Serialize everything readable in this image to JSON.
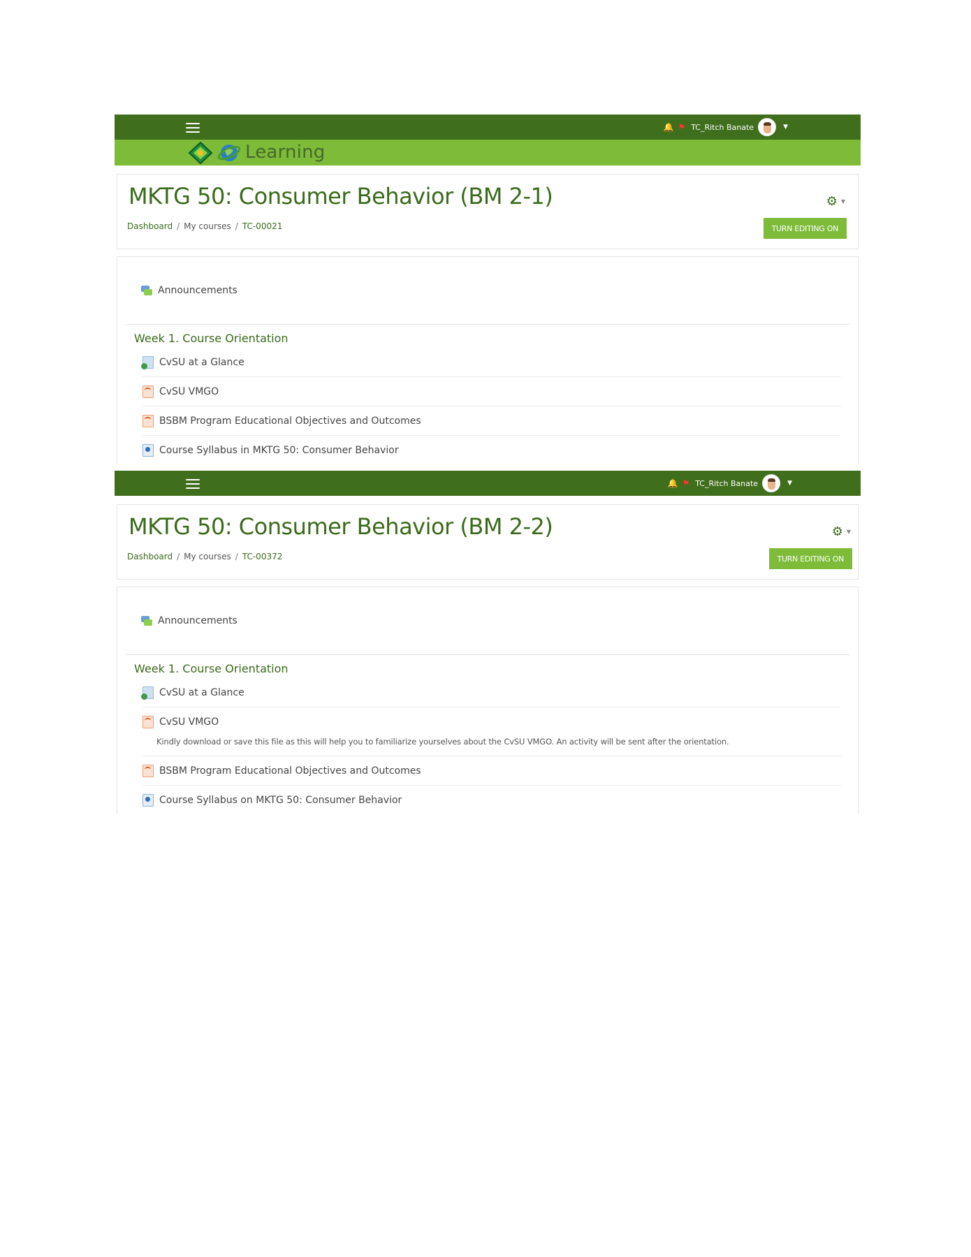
{
  "screens": [
    {
      "user": {
        "name": "TC_Ritch Banate"
      },
      "brand": {
        "logo_text": "Learning"
      },
      "course": {
        "title": "MKTG 50: Consumer Behavior (BM 2-1)",
        "breadcrumb": [
          "Dashboard",
          "My courses",
          "TC-00021"
        ],
        "edit_button": "TURN EDITING ON"
      },
      "announcements": "Announcements",
      "section": {
        "title": "Week 1. Course Orientation",
        "items": [
          {
            "icon": "url-icon",
            "label": "CvSU at a Glance"
          },
          {
            "icon": "pdf-icon",
            "label": "CvSU VMGO"
          },
          {
            "icon": "pdf-icon",
            "label": "BSBM Program Educational Objectives and Outcomes"
          },
          {
            "icon": "doc-icon",
            "label": "Course Syllabus in MKTG 50: Consumer Behavior"
          }
        ]
      }
    },
    {
      "user": {
        "name": "TC_Ritch Banate"
      },
      "course": {
        "title": "MKTG 50: Consumer Behavior (BM 2-2)",
        "breadcrumb": [
          "Dashboard",
          "My courses",
          "TC-00372"
        ],
        "edit_button": "TURN EDITING ON"
      },
      "announcements": "Announcements",
      "section": {
        "title": "Week 1. Course Orientation",
        "items": [
          {
            "icon": "url-icon",
            "label": "CvSU at a Glance"
          },
          {
            "icon": "pdf-icon",
            "label": "CvSU VMGO",
            "description": "Kindly download or save this file as this will help you to familiarize yourselves about the CvSU VMGO. An activity will be sent after the orientation."
          },
          {
            "icon": "pdf-icon",
            "label": "BSBM Program Educational Objectives and Outcomes"
          },
          {
            "icon": "doc-icon",
            "label": "Course Syllabus on MKTG 50: Consumer Behavior"
          }
        ]
      }
    }
  ],
  "colors": {
    "topbar": "#3f6e1c",
    "brandbar": "#7dbb39",
    "accent": "#3a6b1b",
    "button": "#7dbb39"
  }
}
